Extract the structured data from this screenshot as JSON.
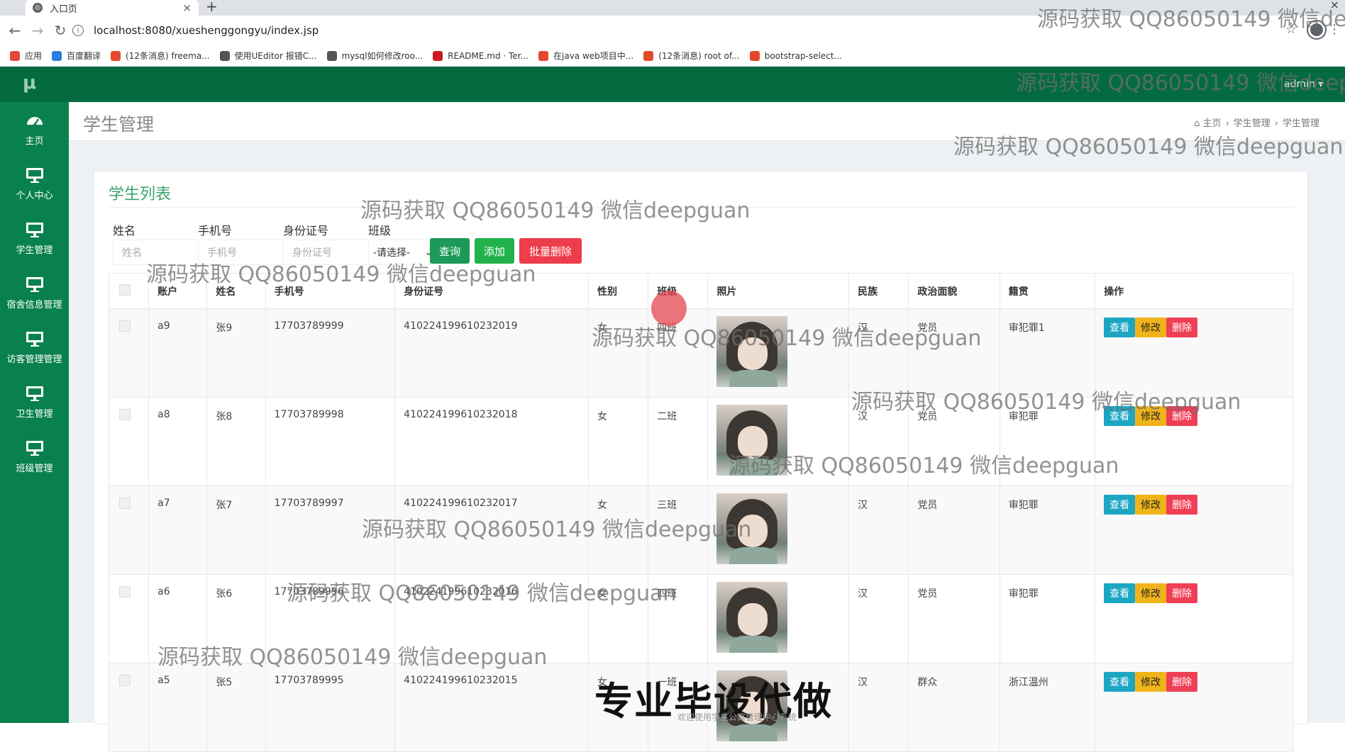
{
  "browser": {
    "tab_title": "入口页",
    "url": "localhost:8080/xueshenggongyu/index.jsp",
    "bookmarks": [
      {
        "label": "应用",
        "icon": "apps-grid-icon",
        "color": "#e8453c"
      },
      {
        "label": "百度翻译",
        "icon": "translate-icon",
        "color": "#2a7de1"
      },
      {
        "label": "(12条消息) freema...",
        "icon": "csdn-icon",
        "color": "#e3492c"
      },
      {
        "label": "使用UEditor 报错C...",
        "icon": "bird-icon",
        "color": "#555555"
      },
      {
        "label": "mysql如何修改roo...",
        "icon": "bird-icon",
        "color": "#555555"
      },
      {
        "label": "README.md · Ter...",
        "icon": "gitee-icon",
        "color": "#c71d23"
      },
      {
        "label": "在java web项目中...",
        "icon": "csdn-icon",
        "color": "#e3492c"
      },
      {
        "label": "(12条消息) root of...",
        "icon": "csdn-icon",
        "color": "#e3492c"
      },
      {
        "label": "bootstrap-select...",
        "icon": "site-icon",
        "color": "#e3492c"
      }
    ]
  },
  "header": {
    "logo": "μ",
    "user": "admin ▾",
    "brand_color": "#046b40"
  },
  "sidebar": {
    "color": "#09814e",
    "items": [
      {
        "label": "主页",
        "icon": "dashboard-icon"
      },
      {
        "label": "个人中心",
        "icon": "monitor-icon"
      },
      {
        "label": "学生管理",
        "icon": "monitor-icon"
      },
      {
        "label": "宿舍信息管理",
        "icon": "monitor-icon"
      },
      {
        "label": "访客管理管理",
        "icon": "monitor-icon"
      },
      {
        "label": "卫生管理",
        "icon": "monitor-icon"
      },
      {
        "label": "班级管理",
        "icon": "monitor-icon"
      }
    ]
  },
  "page": {
    "title": "学生管理",
    "breadcrumb": [
      "主页",
      "学生管理",
      "学生管理"
    ]
  },
  "list": {
    "title": "学生列表",
    "filters": {
      "name_label": "姓名",
      "name_placeholder": "姓名",
      "phone_label": "手机号",
      "phone_placeholder": "手机号",
      "id_label": "身份证号",
      "id_placeholder": "身份证号",
      "class_label": "班级",
      "class_selected": "-请选择-"
    },
    "buttons": {
      "query": "查询",
      "add": "添加",
      "batch_delete": "批量删除"
    },
    "columns": [
      "",
      "账户",
      "姓名",
      "手机号",
      "身份证号",
      "性别",
      "班级",
      "照片",
      "民族",
      "政治面貌",
      "籍贯",
      "操作"
    ],
    "row_actions": {
      "view": "查看",
      "edit": "修改",
      "delete": "删除"
    },
    "rows": [
      {
        "account": "a9",
        "name": "张9",
        "phone": "17703789999",
        "idno": "410224199610232019",
        "gender": "女",
        "class": "四班",
        "nation": "汉",
        "political": "党员",
        "origin": "审犯罪1"
      },
      {
        "account": "a8",
        "name": "张8",
        "phone": "17703789998",
        "idno": "410224199610232018",
        "gender": "女",
        "class": "二班",
        "nation": "汉",
        "political": "党员",
        "origin": "审犯罪"
      },
      {
        "account": "a7",
        "name": "张7",
        "phone": "17703789997",
        "idno": "410224199610232017",
        "gender": "女",
        "class": "三班",
        "nation": "汉",
        "political": "党员",
        "origin": "审犯罪"
      },
      {
        "account": "a6",
        "name": "张6",
        "phone": "17703789996",
        "idno": "410224199610232016",
        "gender": "女",
        "class": "四班",
        "nation": "汉",
        "political": "党员",
        "origin": "审犯罪"
      },
      {
        "account": "a5",
        "name": "张5",
        "phone": "17703789995",
        "idno": "410224199610232015",
        "gender": "女",
        "class": "一班",
        "nation": "汉",
        "political": "群众",
        "origin": "浙江温州"
      }
    ]
  },
  "watermarks": {
    "small": "源码获取 QQ86050149 微信deepguan",
    "small_cut1": "源码获取 QQ86050149 微信dee",
    "small_cut2": "源码获取 QQ86050149 微信deep",
    "big": "专业毕设代做"
  },
  "footer": "欢迎使用学生公寓管理中心系统"
}
